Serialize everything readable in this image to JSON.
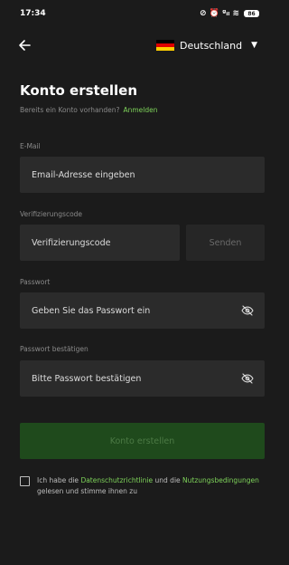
{
  "status_bar": {
    "time": "17:34",
    "icons": "⊘ ⏰ ᵍᵢₗ ≋",
    "battery": "86"
  },
  "header": {
    "language": "Deutschland",
    "back_icon": "arrow-left-icon",
    "flag": "germany-flag",
    "flag_colors": [
      "#000000",
      "#dd0000",
      "#ffce00"
    ]
  },
  "page": {
    "title": "Konto erstellen",
    "login_prompt": "Bereits ein Konto vorhanden?",
    "login_link": "Anmelden"
  },
  "form": {
    "email_label": "E-Mail",
    "email_placeholder": "Email-Adresse eingeben",
    "code_label": "Verifizierungscode",
    "code_placeholder": "Verifizierungscode",
    "send_label": "Senden",
    "password_label": "Passwort",
    "password_placeholder": "Geben Sie das Passwort ein",
    "confirm_label": "Passwort bestätigen",
    "confirm_placeholder": "Bitte Passwort bestätigen",
    "submit_label": "Konto erstellen"
  },
  "consent": {
    "text_1": "Ich habe die",
    "privacy_link": "Datenschutzrichtlinie",
    "text_2": "und die",
    "terms_link": "Nutzungsbedingungen",
    "text_3": "gelesen und stimme ihnen zu"
  },
  "colors": {
    "background": "#1b1b1b",
    "accent": "#7ed35a",
    "field": "#2b2b2b",
    "submit_disabled": "#1f4a1c"
  }
}
